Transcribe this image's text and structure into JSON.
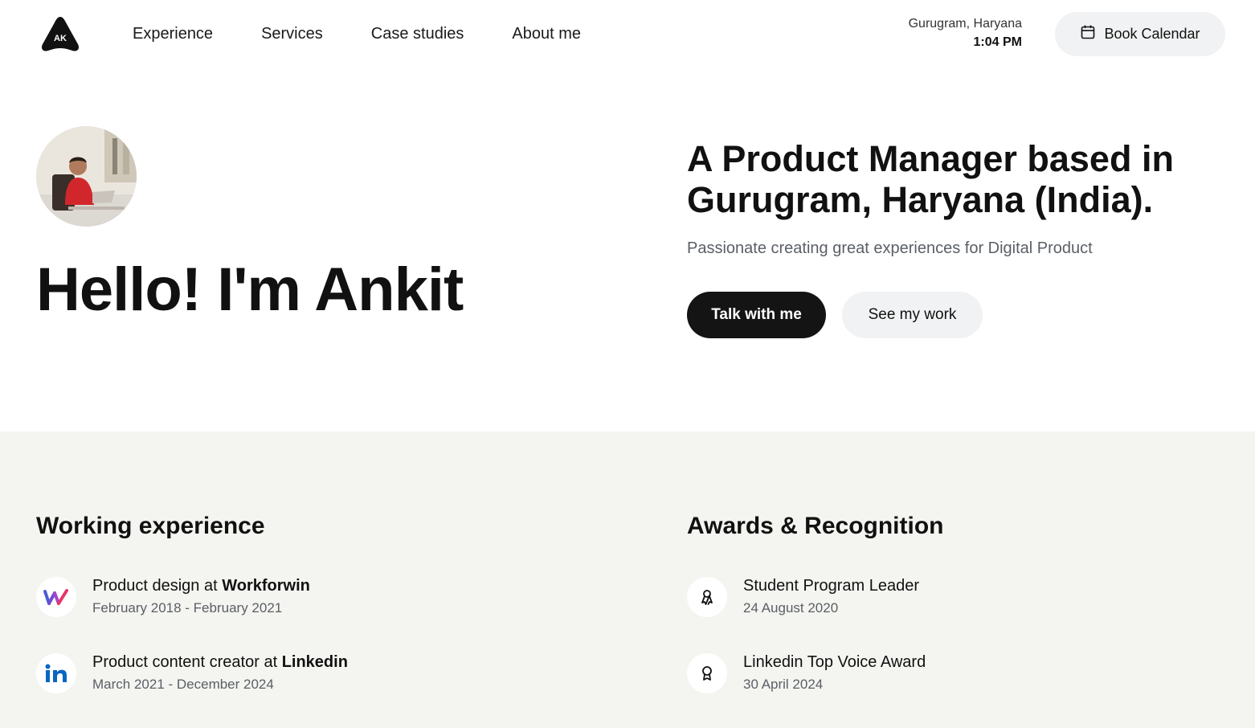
{
  "header": {
    "logo_text": "AK",
    "nav": [
      "Experience",
      "Services",
      "Case studies",
      "About me"
    ],
    "location_city": "Gurugram, Haryana",
    "location_time": "1:04 PM",
    "book_label": "Book Calendar"
  },
  "hero": {
    "greeting": "Hello! I'm Ankit",
    "headline": "A Product Manager based in Gurugram, Haryana (India).",
    "subline": "Passionate creating great experiences for Digital Product",
    "primary_cta": "Talk with me",
    "secondary_cta": "See my work"
  },
  "experience": {
    "title": "Working experience",
    "items": [
      {
        "role": "Product design at ",
        "company": "Workforwin",
        "dates": "February 2018 - February 2021",
        "icon": "workforwin-logo-icon"
      },
      {
        "role": "Product content creator at ",
        "company": "Linkedin",
        "dates": "March 2021 - December 2024",
        "icon": "linkedin-logo-icon"
      }
    ]
  },
  "awards": {
    "title": "Awards & Recognition",
    "items": [
      {
        "name": "Student Program Leader",
        "date": "24 August 2020",
        "icon": "ribbon-icon"
      },
      {
        "name": "Linkedin Top Voice Award",
        "date": "30 April 2024",
        "icon": "award-medal-icon"
      }
    ]
  },
  "colors": {
    "dark_button": "#141414",
    "light_button": "#f1f2f3",
    "section_bg": "#f4f4f0",
    "linkedin_blue": "#0a66c2"
  }
}
